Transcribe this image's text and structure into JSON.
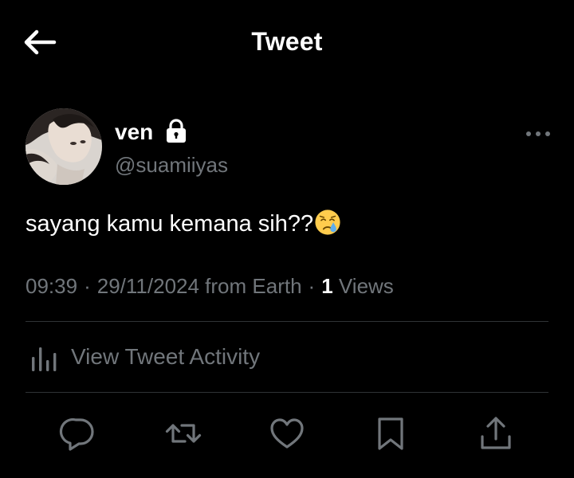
{
  "header": {
    "title": "Tweet",
    "back_icon": "arrow-left-icon"
  },
  "author": {
    "display_name": "ven",
    "handle": "@suamiiyas",
    "protected_icon": "lock-icon",
    "more_icon": "more-horizontal-icon"
  },
  "tweet": {
    "text": "sayang kamu kemana sih??",
    "emoji": "crying-face-emoji"
  },
  "meta": {
    "time": "09:39",
    "separator": "·",
    "date_source": "29/11/2024 from Earth",
    "views_count": "1",
    "views_label": "Views"
  },
  "activity": {
    "label": "View Tweet Activity",
    "icon": "bar-chart-icon"
  },
  "actions": [
    {
      "name": "reply",
      "icon": "reply-icon"
    },
    {
      "name": "retweet",
      "icon": "retweet-icon"
    },
    {
      "name": "like",
      "icon": "heart-icon"
    },
    {
      "name": "bookmark",
      "icon": "bookmark-icon"
    },
    {
      "name": "share",
      "icon": "share-icon"
    }
  ],
  "colors": {
    "background": "#000000",
    "text_primary": "#ffffff",
    "text_secondary": "#71767b",
    "divider": "#2f3336"
  }
}
